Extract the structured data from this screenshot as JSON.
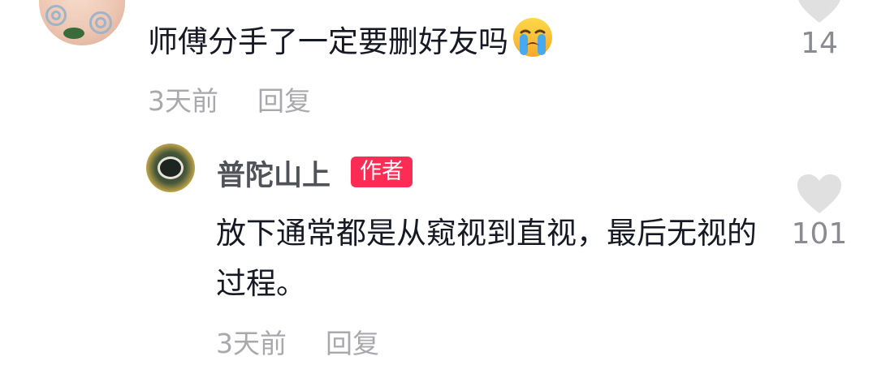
{
  "comment": {
    "text": "师傅分手了一定要删好友吗",
    "emoji": "crying-face",
    "time": "3天前",
    "reply_label": "回复",
    "likes": "14"
  },
  "reply": {
    "username": "普陀山上",
    "badge": "作者",
    "text": "放下通常都是从窥视到直视，最后无视的过程。",
    "time": "3天前",
    "reply_label": "回复",
    "likes": "101"
  },
  "colors": {
    "badge": "#fe2c55",
    "meta_text": "#a8a8ad",
    "like_icon": "#e0e0e0"
  }
}
